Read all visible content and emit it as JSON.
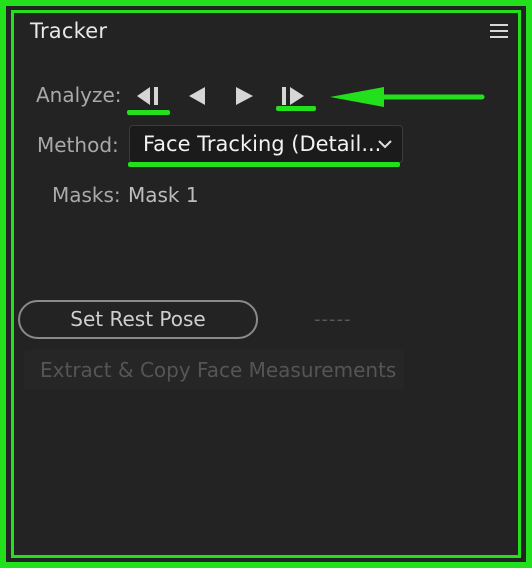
{
  "panel": {
    "title": "Tracker",
    "menu_icon": "hamburger-icon"
  },
  "analyze": {
    "label": "Analyze:",
    "buttons": [
      {
        "name": "track-backward-all",
        "icon": "step-back-bar-icon"
      },
      {
        "name": "track-backward-one",
        "icon": "triangle-left-icon"
      },
      {
        "name": "track-forward-one",
        "icon": "triangle-right-icon"
      },
      {
        "name": "track-forward-all",
        "icon": "bar-step-forward-icon"
      }
    ]
  },
  "method": {
    "label": "Method:",
    "selected": "Face Tracking (Detail...",
    "chevron_icon": "chevron-down-icon"
  },
  "masks": {
    "label": "Masks:",
    "value": "Mask 1"
  },
  "rest_pose": {
    "button_label": "Set Rest Pose",
    "status": "-----"
  },
  "extract": {
    "button_label": "Extract & Copy Face Measurements"
  },
  "annotation": {
    "color": "#22e01c",
    "arrow_icon": "left-arrow-icon"
  }
}
